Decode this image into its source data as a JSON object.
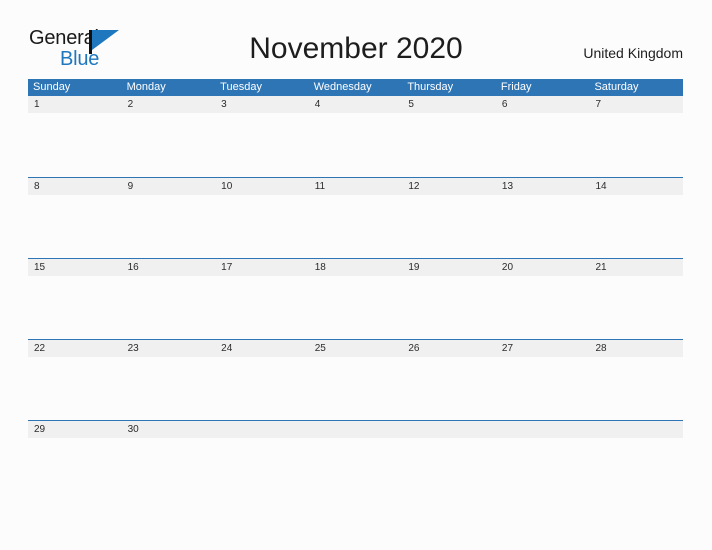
{
  "brand": {
    "name_part1": "General",
    "name_part2": "Blue",
    "flag_icon": "flag-triangle-icon",
    "accent_color": "#1f77be"
  },
  "header": {
    "title": "November 2020",
    "country": "United Kingdom"
  },
  "calendar": {
    "month": "November",
    "year": "2020",
    "header_color": "#2e75b6",
    "band_color": "#f0f0f0",
    "rule_color": "#2e75b6",
    "weekdays": [
      "Sunday",
      "Monday",
      "Tuesday",
      "Wednesday",
      "Thursday",
      "Friday",
      "Saturday"
    ],
    "weeks": [
      {
        "days": [
          "1",
          "2",
          "3",
          "4",
          "5",
          "6",
          "7"
        ]
      },
      {
        "days": [
          "8",
          "9",
          "10",
          "11",
          "12",
          "13",
          "14"
        ]
      },
      {
        "days": [
          "15",
          "16",
          "17",
          "18",
          "19",
          "20",
          "21"
        ]
      },
      {
        "days": [
          "22",
          "23",
          "24",
          "25",
          "26",
          "27",
          "28"
        ]
      },
      {
        "days": [
          "29",
          "30",
          "",
          "",
          "",
          "",
          ""
        ]
      }
    ]
  }
}
